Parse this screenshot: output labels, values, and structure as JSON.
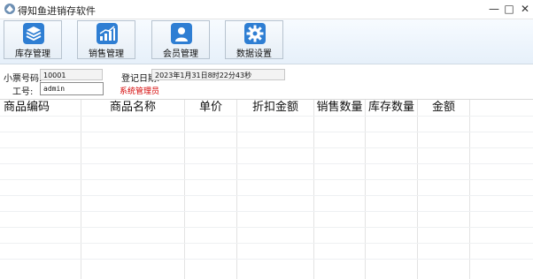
{
  "window": {
    "title": "得知鱼进销存软件",
    "minimize_glyph": "—",
    "maximize_glyph": "□",
    "close_glyph": "✕"
  },
  "toolbar": {
    "buttons": [
      {
        "label": "库存管理",
        "icon": "layers-icon"
      },
      {
        "label": "销售管理",
        "icon": "bar-chart-icon"
      },
      {
        "label": "会员管理",
        "icon": "user-icon"
      },
      {
        "label": "数据设置",
        "icon": "gear-icon"
      }
    ],
    "accent_color": "#2e7ed3"
  },
  "form": {
    "receipt_label": "小票号码:",
    "receipt_value": "10001",
    "date_label": "登记日期:",
    "date_value": "2023年1月31日8时22分43秒",
    "staff_label": "工号:",
    "staff_value": "admin",
    "role_text": "系统管理员",
    "role_color": "#d40000"
  },
  "table": {
    "columns": [
      "商品编码",
      "商品名称",
      "单价",
      "折扣金额",
      "销售数量",
      "库存数量",
      "金额"
    ],
    "rows": []
  }
}
